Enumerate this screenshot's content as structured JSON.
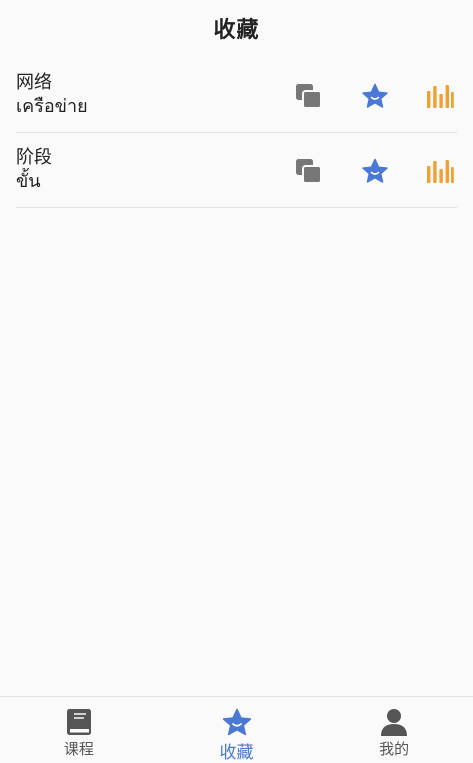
{
  "header": {
    "title": "收藏"
  },
  "favorites": [
    {
      "word": "网络",
      "translation": "เครือข่าย"
    },
    {
      "word": "阶段",
      "translation": "ขั้น"
    }
  ],
  "icons": {
    "copy": "copy-icon",
    "star": "star-icon",
    "bars": "bar-chart-icon"
  },
  "colors": {
    "copy": "#777777",
    "star": "#4a78d6",
    "bars": "#f0a030",
    "active_tab": "#4a78d6",
    "inactive_tab": "#555555"
  },
  "tabbar": {
    "tabs": [
      {
        "label": "课程",
        "icon": "book-icon"
      },
      {
        "label": "收藏",
        "icon": "star-icon",
        "active": true
      },
      {
        "label": "我的",
        "icon": "person-icon"
      }
    ]
  }
}
